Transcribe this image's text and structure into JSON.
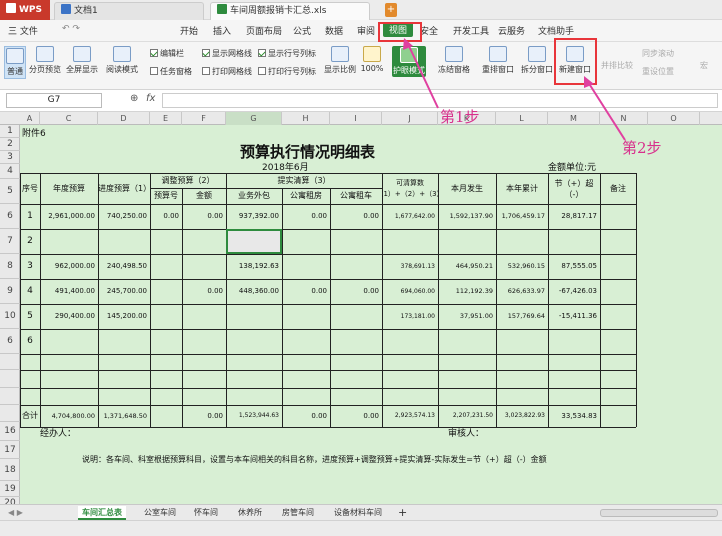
{
  "titlebar": {
    "app_name": "WPS",
    "tabs": [
      {
        "label": "文档1"
      },
      {
        "label": "车间周额报销卡汇总.xls"
      }
    ],
    "new_tab": "+"
  },
  "menu": {
    "file": "三 文件",
    "items": [
      "开始",
      "插入",
      "页面布局",
      "公式",
      "数据",
      "审阅",
      "视图",
      "安全",
      "开发工具",
      "云服务",
      "文档助手"
    ],
    "active": "视图"
  },
  "ribbon": {
    "buttons": {
      "normal": "普通",
      "page_break": "分页预览",
      "full_screen": "全屏显示",
      "reading_mode": "阅读模式",
      "show_ratio": "显示比例",
      "zoom_100": "100%",
      "eye_protect": "护眼模式",
      "freeze": "冻结窗格",
      "rearrange": "重排窗口",
      "split": "拆分窗口",
      "new_window": "新建窗口",
      "side_by_side": "并排比较",
      "sync_scroll": "同步滚动",
      "reset_position": "重设位置",
      "macro": "宏"
    },
    "checks": [
      {
        "label": "编辑栏",
        "checked": true
      },
      {
        "label": "任务窗格",
        "checked": false
      },
      {
        "label": "显示网格线",
        "checked": true
      },
      {
        "label": "打印网格线",
        "checked": false
      },
      {
        "label": "显示行号列标",
        "checked": true
      },
      {
        "label": "打印行号列标",
        "checked": false
      }
    ]
  },
  "formula_bar": {
    "name_box": "G7",
    "fx": "fx"
  },
  "columns": [
    "A",
    "C",
    "D",
    "E",
    "F",
    "G",
    "H",
    "I",
    "J",
    "K",
    "L",
    "M",
    "N",
    "O"
  ],
  "rows": [
    "1",
    "2",
    "3",
    "4",
    "5",
    "6",
    "7",
    "8",
    "9",
    "10",
    "6",
    "",
    "",
    "",
    "",
    "16",
    "17",
    "18",
    "19",
    "20"
  ],
  "sheet": {
    "attachment": "附件6",
    "title": "预算执行情况明细表",
    "date": "2018年6月",
    "unit": "金额单位:元",
    "headers": {
      "seq": "序号",
      "annual_budget": "年度预算",
      "progress_budget": "进度预算（1）",
      "adjust_budget": "调整预算（2）",
      "budget_no": "预算号",
      "amount": "金额",
      "clear_budget": "提实清算（3）",
      "outsourcing": "业务外包",
      "office_rent": "公寓租房",
      "office_car": "公寓租车",
      "available": "可清算数（1）+（2）+（3）",
      "month_actual": "本月发生",
      "year_total": "本年累计",
      "saving": "节（+）超（-）",
      "remark": "备注"
    },
    "data_rows": [
      {
        "seq": "1",
        "annual": "2,961,000.00",
        "progress": "740,250.00",
        "budget_no": "0.00",
        "amount": "0.00",
        "outsourcing": "937,392.00",
        "rent": "0.00",
        "car": "0.00",
        "available": "1,677,642.00",
        "month": "1,592,137.90",
        "year": "1,706,459.17",
        "saving": "28,817.17"
      },
      {
        "seq": "2",
        "annual": "",
        "progress": "",
        "budget_no": "",
        "amount": "",
        "outsourcing": "",
        "rent": "",
        "car": "",
        "available": "",
        "month": "",
        "year": "",
        "saving": ""
      },
      {
        "seq": "3",
        "annual": "962,000.00",
        "progress": "240,498.50",
        "budget_no": "",
        "amount": "",
        "outsourcing": "138,192.63",
        "rent": "",
        "car": "",
        "available": "378,691.13",
        "month": "464,950.21",
        "year": "532,960.15",
        "saving": "87,555.05"
      },
      {
        "seq": "4",
        "annual": "491,400.00",
        "progress": "245,700.00",
        "budget_no": "",
        "amount": "0.00",
        "outsourcing": "448,360.00",
        "rent": "0.00",
        "car": "0.00",
        "available": "694,060.00",
        "month": "112,192.39",
        "year": "626,633.97",
        "saving": "-67,426.03"
      },
      {
        "seq": "5",
        "annual": "290,400.00",
        "progress": "145,200.00",
        "budget_no": "",
        "amount": "",
        "outsourcing": "",
        "rent": "",
        "car": "",
        "available": "173,181.00",
        "month": "37,951.00",
        "year": "157,769.64",
        "saving": "-15,411.36"
      },
      {
        "seq": "6",
        "annual": "",
        "progress": "",
        "budget_no": "",
        "amount": "",
        "outsourcing": "",
        "rent": "",
        "car": "",
        "available": "",
        "month": "",
        "year": "",
        "saving": ""
      }
    ],
    "total_row": {
      "label": "合计",
      "annual": "4,704,800.00",
      "progress": "1,371,648.50",
      "amount": "0.00",
      "outsourcing": "1,523,944.63",
      "rent": "0.00",
      "car": "0.00",
      "available": "2,923,574.13",
      "month": "2,207,231.50",
      "year": "3,023,822.93",
      "saving": "33,534.83"
    },
    "handler": "经办人：",
    "reviewer": "审核人：",
    "note": "说明：各车间、科室根据预算科目，设置与本车间相关的科目名称，进度预算+调整预算+提实清算-实际发生=节（+）超（-）金额"
  },
  "sheet_tabs": [
    "车间汇总表",
    "公室车间",
    "怀车间",
    "休养所",
    "房管车间",
    "设备材料车间"
  ],
  "active_sheet": "车间汇总表",
  "add_sheet": "+",
  "annotations": {
    "step1": "第1步",
    "step2": "第2步"
  },
  "colors": {
    "accent": "#2e8b3e",
    "wps_red": "#c9392b",
    "highlight": "#e8353a",
    "annotation": "#d8308c",
    "sheet_fill": "#d8efd4"
  }
}
